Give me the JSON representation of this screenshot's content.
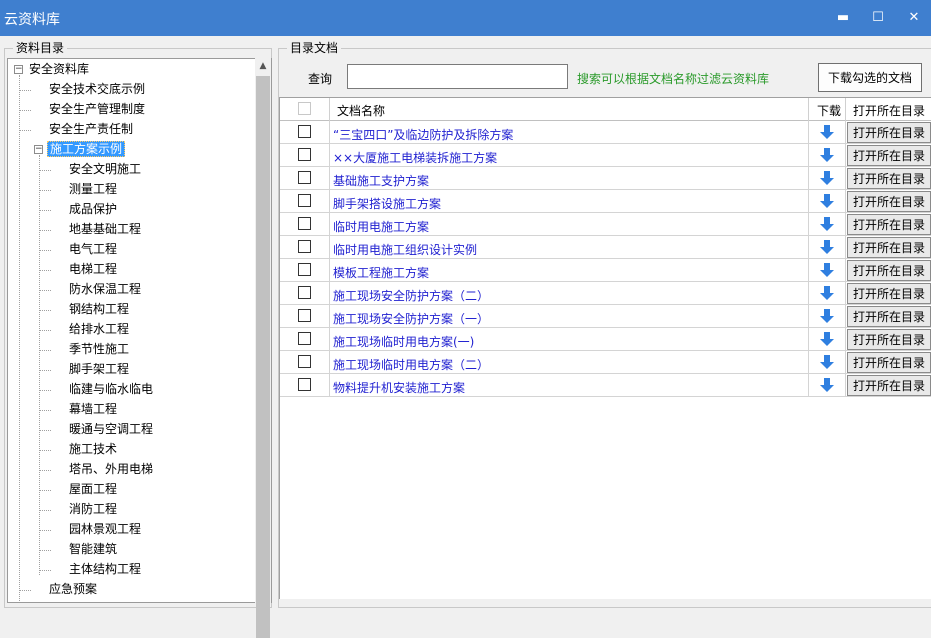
{
  "window": {
    "title": "云资料库",
    "controls": {
      "minimize": "▬",
      "maximize": "☐",
      "close": "✕"
    }
  },
  "left_panel": {
    "legend": "资料目录",
    "tree": [
      {
        "label": "安全资料库",
        "level": 0,
        "expander": "−"
      },
      {
        "label": "安全技术交底示例",
        "level": 1
      },
      {
        "label": "安全生产管理制度",
        "level": 1
      },
      {
        "label": "安全生产责任制",
        "level": 1
      },
      {
        "label": "施工方案示例",
        "level": 1,
        "expander": "−",
        "selected": true
      },
      {
        "label": "安全文明施工",
        "level": 2
      },
      {
        "label": "测量工程",
        "level": 2
      },
      {
        "label": "成品保护",
        "level": 2
      },
      {
        "label": "地基基础工程",
        "level": 2
      },
      {
        "label": "电气工程",
        "level": 2
      },
      {
        "label": "电梯工程",
        "level": 2
      },
      {
        "label": "防水保温工程",
        "level": 2
      },
      {
        "label": "钢结构工程",
        "level": 2
      },
      {
        "label": "给排水工程",
        "level": 2
      },
      {
        "label": "季节性施工",
        "level": 2
      },
      {
        "label": "脚手架工程",
        "level": 2
      },
      {
        "label": "临建与临水临电",
        "level": 2
      },
      {
        "label": "幕墙工程",
        "level": 2
      },
      {
        "label": "暖通与空调工程",
        "level": 2
      },
      {
        "label": "施工技术",
        "level": 2
      },
      {
        "label": "塔吊、外用电梯",
        "level": 2
      },
      {
        "label": "屋面工程",
        "level": 2
      },
      {
        "label": "消防工程",
        "level": 2
      },
      {
        "label": "园林景观工程",
        "level": 2
      },
      {
        "label": "智能建筑",
        "level": 2
      },
      {
        "label": "主体结构工程",
        "level": 2
      },
      {
        "label": "应急预案",
        "level": 1
      }
    ]
  },
  "right_panel": {
    "legend": "目录文档",
    "search": {
      "label": "查询",
      "value": "",
      "placeholder": "",
      "hint": "搜索可以根据文档名称过滤云资料库"
    },
    "download_checked_label": "下载勾选的文档",
    "columns": {
      "name": "文档名称",
      "download": "下载",
      "open": "打开所在目录"
    },
    "open_button_label": "打开所在目录",
    "documents": [
      "“三宝四口”及临边防护及拆除方案",
      "××大厦施工电梯装拆施工方案",
      "基础施工支护方案",
      "脚手架搭设施工方案",
      "临时用电施工方案",
      "临时用电施工组织设计实例",
      "模板工程施工方案",
      "施工现场安全防护方案（二）",
      "施工现场安全防护方案（一）",
      "施工现场临时用电方案(一)",
      "施工现场临时用电方案（二）",
      "物料提升机安装施工方案"
    ]
  },
  "colors": {
    "title_bar": "#3f7fcf",
    "hint_text": "#2a9a2a",
    "link_text": "#1f1fd0",
    "selection": "#3399ff",
    "download_arrow": "#2f7fe0"
  }
}
